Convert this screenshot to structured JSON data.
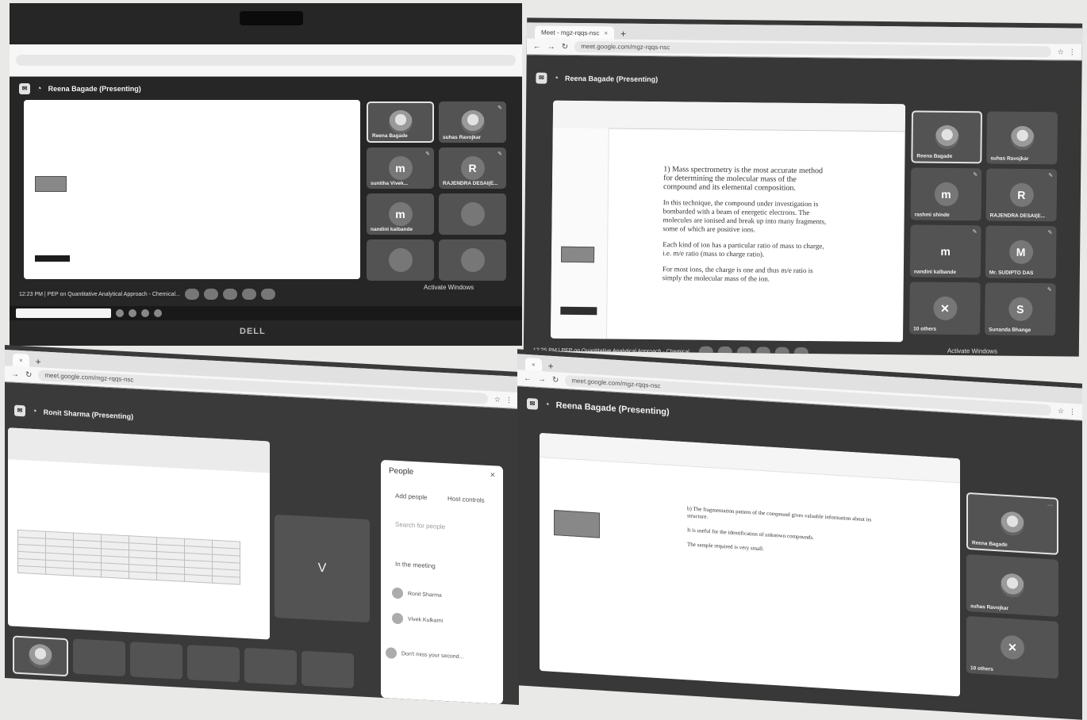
{
  "photo1": {
    "presenter_header": "Reena Bagade (Presenting)",
    "tiles": [
      {
        "name": "Reena Bagade",
        "initial": "",
        "photo": true,
        "active": true
      },
      {
        "name": "suhas Ravojkar",
        "initial": "",
        "photo": true
      },
      {
        "name": "sunitha Vivek...",
        "initial": "m"
      },
      {
        "name": "RAJENDRA DESAI(E...",
        "initial": "R"
      },
      {
        "name": "nandini kalbande",
        "initial": "m"
      },
      {
        "name": "",
        "initial": ""
      },
      {
        "name": "",
        "initial": ""
      },
      {
        "name": "",
        "initial": ""
      }
    ],
    "meeting_info": "12:23 PM | PEP on Quantitative Analytical Approach - Chemical...",
    "monitor_brand": "DELL",
    "activate_windows": "Activate Windows"
  },
  "photo2": {
    "tab_title": "Meet - mgz-rqqs-nsc",
    "url": "meet.google.com/mgz-rqqs-nsc",
    "presenter_header": "Reena Bagade (Presenting)",
    "doc_paragraphs": [
      "1) Mass spectrometry is the most accurate method for determining the molecular mass of the compound and its elemental composition.",
      "In this technique, the compound under investigation is bombarded with a beam of energetic electrons. The molecules are ionised and break up into many fragments, some of which are positive ions.",
      "Each kind of ion has a particular ratio of mass to charge, i.e. m/e ratio (mass to charge ratio).",
      "For most ions, the charge is one and thus m/e ratio is simply the molecular mass of the ion."
    ],
    "tiles": [
      {
        "name": "Reena Bagade",
        "initial": "",
        "photo": true,
        "active": true
      },
      {
        "name": "suhas Ravojkar",
        "initial": "",
        "photo": true
      },
      {
        "name": "rashmi shinde",
        "initial": "m"
      },
      {
        "name": "RAJENDRA DESAI(E...",
        "initial": "R"
      },
      {
        "name": "nandini kalbande",
        "initial": "m"
      },
      {
        "name": "Mr. SUDIPTO DAS",
        "initial": "M"
      },
      {
        "name": "10 others",
        "initial": "✕"
      },
      {
        "name": "Sunanda Bhange",
        "initial": "S"
      }
    ],
    "meeting_info": "12:25 PM | PEP on Quantitative Analytical Approach - Chemical...",
    "activate_windows": "Activate Windows"
  },
  "photo3": {
    "url": "meet.google.com/mgz-rqqs-nsc",
    "presenter_header": "Ronit Sharma (Presenting)",
    "center_tile_initial": "V",
    "people_panel": {
      "title": "People",
      "add_people": "Add people",
      "host_controls": "Host controls",
      "search_placeholder": "Search for people",
      "section": "In the meeting",
      "rows": [
        "Ronit Sharma",
        "Vivek Kulkarni"
      ],
      "footer": "Don't miss your second..."
    }
  },
  "photo4": {
    "url": "meet.google.com/mgz-rqqs-nsc",
    "presenter_header": "Reena Bagade (Presenting)",
    "doc_lines": [
      "b) The fragmentation pattern of the compound gives valuable information about its structure.",
      "It is useful for the identification of unknown compounds.",
      "The sample required is very small."
    ],
    "tiles": [
      {
        "name": "Reena Bagade",
        "initial": "",
        "photo": true,
        "active": true
      },
      {
        "name": "suhas Ravojkar",
        "initial": "",
        "photo": true
      },
      {
        "name": "10 others",
        "initial": "✕"
      }
    ]
  }
}
